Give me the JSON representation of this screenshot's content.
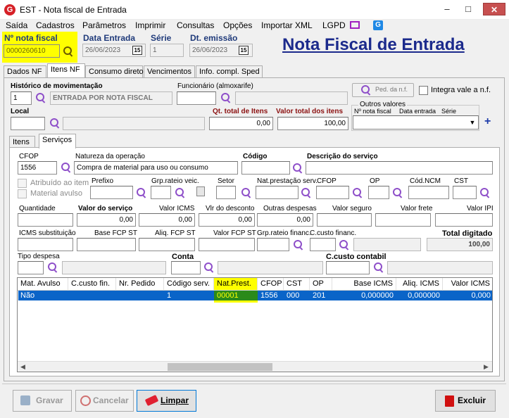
{
  "window": {
    "title": "EST - Nota fiscal de Entrada",
    "icon_letter": "G"
  },
  "menu": [
    "Saída",
    "Cadastros",
    "Parâmetros",
    "Imprimir",
    "Consultas",
    "Opções",
    "Importar XML",
    "LGPD"
  ],
  "header": {
    "nota_label": "Nº nota fiscal",
    "nota_value": "0000260610",
    "data_entrada_label": "Data Entrada",
    "data_entrada_value": "26/06/2023",
    "serie_label": "Série",
    "serie_value": "1",
    "dt_emissao_label": "Dt. emissão",
    "dt_emissao_value": "26/06/2023",
    "calendar_glyph": "15",
    "page_title": "Nota Fiscal de Entrada"
  },
  "tabs": [
    "Dados NF",
    "Itens NF",
    "Consumo direto",
    "Vencimentos",
    "Info. compl. Sped"
  ],
  "itens": {
    "historico_label": "Histórico de movimentação",
    "historico_code": "1",
    "historico_desc": "ENTRADA POR NOTA FISCAL",
    "funcionario_label": "Funcionário (almoxarife)",
    "funcionario_code": "",
    "funcionario_desc": "",
    "ped_button": "Ped. da n.f.",
    "integra_label": "Integra vale a n.f.",
    "local_label": "Local",
    "local_code": "",
    "local_desc": "",
    "qt_total_label": "Qt. total de Itens",
    "qt_total_value": "0,00",
    "valor_total_label": "Valor total dos itens",
    "valor_total_value": "100,00",
    "outros_valores_label": "Outros valores",
    "outros_cols": [
      "Nº nota fiscal",
      "Data entrada",
      "Série"
    ],
    "plus_glyph": "+"
  },
  "subtabs": [
    "Itens",
    "Serviços"
  ],
  "servicos": {
    "cfop_label": "CFOP",
    "cfop_value": "1556",
    "natureza_label": "Natureza da operação",
    "natureza_value": "Compra de material para uso ou consumo",
    "codigo_label": "Código",
    "codigo_value": "",
    "descricao_label": "Descrição do serviço",
    "descricao_value": "",
    "atribuido_label": "Atribuído ao item",
    "material_avulso_label": "Material avulso",
    "prefixo_label": "Prefixo",
    "grp_rateio_label": "Grp.rateio veic.",
    "setor_label": "Setor",
    "nat_prest_label": "Nat.prestação serv.",
    "cfop2_label": "CFOP",
    "op_label": "OP",
    "cod_ncm_label": "Cód.NCM",
    "cst_label": "CST",
    "quantidade_label": "Quantidade",
    "valor_servico_label": "Valor do serviço",
    "valor_servico_value": "0,00",
    "valor_icms_label": "Valor ICMS",
    "valor_icms_value": "0,00",
    "vlr_desconto_label": "Vlr do desconto",
    "vlr_desconto_value": "0,00",
    "outras_despesas_label": "Outras despesas",
    "outras_despesas_value": "0,00",
    "valor_seguro_label": "Valor seguro",
    "valor_frete_label": "Valor frete",
    "valor_ipi_label": "Valor IPI",
    "icms_subst_label": "ICMS substituição",
    "base_fcp_label": "Base FCP ST",
    "aliq_fcp_label": "Aliq. FCP ST",
    "valor_fcp_label": "Valor FCP ST",
    "grp_rateio_fin_label": "Grp.rateio financ.",
    "ccusto_fin_label": "C.custo financ.",
    "total_digitado_label": "Total digitado",
    "total_digitado_value": "100,00",
    "tipo_despesa_label": "Tipo despesa",
    "conta_label": "Conta",
    "ccusto_contabil_label": "C.custo contabil"
  },
  "grid": {
    "columns": [
      "Mat. Avulso",
      "C.custo fin.",
      "Nr. Pedido",
      "Código serv.",
      "Nat.Prest.",
      "CFOP",
      "CST",
      "OP",
      "Base ICMS",
      "Aliq. ICMS",
      "Valor ICMS"
    ],
    "rows": [
      [
        "Não",
        "",
        "",
        "1",
        "00001",
        "1556",
        "000",
        "201",
        "0,000000",
        "0,000000",
        "0,000"
      ]
    ]
  },
  "buttons": {
    "gravar": "Gravar",
    "cancelar": "Cancelar",
    "limpar": "Limpar",
    "excluir": "Excluir"
  },
  "colors": {
    "highlight": "#ffff00",
    "title_blue": "#1b2a8c",
    "selected_row": "#0a64c8",
    "close_red": "#c75050"
  }
}
